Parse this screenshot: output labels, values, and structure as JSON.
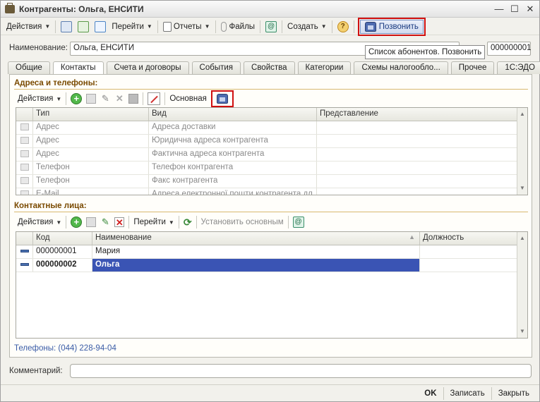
{
  "window": {
    "title": "Контрагенты: Ольга, ЕНСИТИ"
  },
  "toolbar": {
    "actions_label": "Действия",
    "goto_label": "Перейти",
    "reports_label": "Отчеты",
    "files_label": "Файлы",
    "create_label": "Создать",
    "help_label": "?",
    "call_label": "Позвонить"
  },
  "tooltip": {
    "text": "Список абонентов. Позвонить"
  },
  "form": {
    "name_label": "Наименование:",
    "name_value": "Ольга, ЕНСИТИ",
    "code_value": "000000001",
    "comment_label": "Комментарий:",
    "comment_value": ""
  },
  "tabs": [
    {
      "label": "Общие"
    },
    {
      "label": "Контакты"
    },
    {
      "label": "Счета и договоры"
    },
    {
      "label": "События"
    },
    {
      "label": "Свойства"
    },
    {
      "label": "Категории"
    },
    {
      "label": "Схемы налогообло..."
    },
    {
      "label": "Прочее"
    },
    {
      "label": "1С:ЭДО"
    }
  ],
  "addresses": {
    "title": "Адреса и телефоны:",
    "actions_label": "Действия",
    "main_label": "Основная",
    "columns": [
      "Тип",
      "Вид",
      "Представление"
    ],
    "rows": [
      {
        "type": "Адрес",
        "kind": "Адреса доставки",
        "repr": ""
      },
      {
        "type": "Адрес",
        "kind": "Юридична адреса контрагента",
        "repr": ""
      },
      {
        "type": "Адрес",
        "kind": "Фактична адреса контрагента",
        "repr": ""
      },
      {
        "type": "Телефон",
        "kind": "Телефон контрагента",
        "repr": ""
      },
      {
        "type": "Телефон",
        "kind": "Факс контрагента",
        "repr": ""
      },
      {
        "type": "E-Mail",
        "kind": "Адреса електронної пошти контрагента дл...",
        "repr": ""
      }
    ]
  },
  "contacts": {
    "title": "Контактные лица:",
    "actions_label": "Действия",
    "goto_label": "Перейти",
    "set_main_label": "Установить основным",
    "columns": [
      "Код",
      "Наименование",
      "Должность"
    ],
    "rows": [
      {
        "code": "000000001",
        "name": "Мария",
        "position": ""
      },
      {
        "code": "000000002",
        "name": "Ольга",
        "position": ""
      }
    ]
  },
  "phones_text": "Телефоны: (044) 228-94-04",
  "statusbar": {
    "ok_label": "OK",
    "save_label": "Записать",
    "close_label": "Закрыть"
  }
}
